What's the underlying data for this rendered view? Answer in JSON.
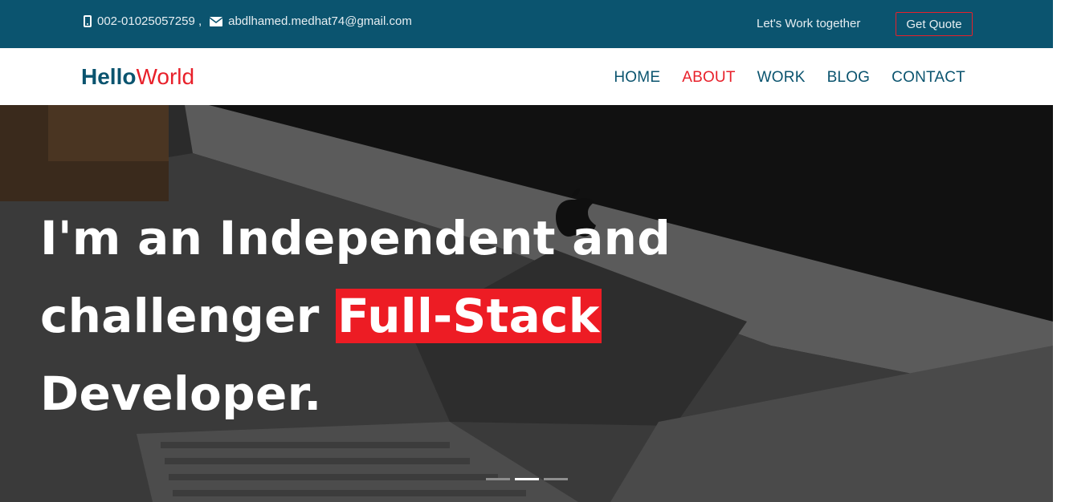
{
  "topbar": {
    "phone": "002-01025057259 ,",
    "email": "abdlhamed.medhat74@gmail.com",
    "work_text": "Let's Work together",
    "quote_button": "Get Quote"
  },
  "logo": {
    "bold": "Hello",
    "light": "World"
  },
  "nav": {
    "items": [
      {
        "label": "HOME",
        "active": false
      },
      {
        "label": "ABOUT",
        "active": true
      },
      {
        "label": "WORK",
        "active": false
      },
      {
        "label": "BLOG",
        "active": false
      },
      {
        "label": "CONTACT",
        "active": false
      }
    ]
  },
  "hero": {
    "line1": "I'm an Independent and",
    "line2_pre": "challenger ",
    "line2_highlight": "Full-Stack",
    "line3": "Developer.",
    "slides": {
      "count": 3,
      "active_index": 1
    }
  },
  "colors": {
    "primary": "#0b546f",
    "accent": "#e8202a",
    "highlight": "#ed1c24"
  }
}
